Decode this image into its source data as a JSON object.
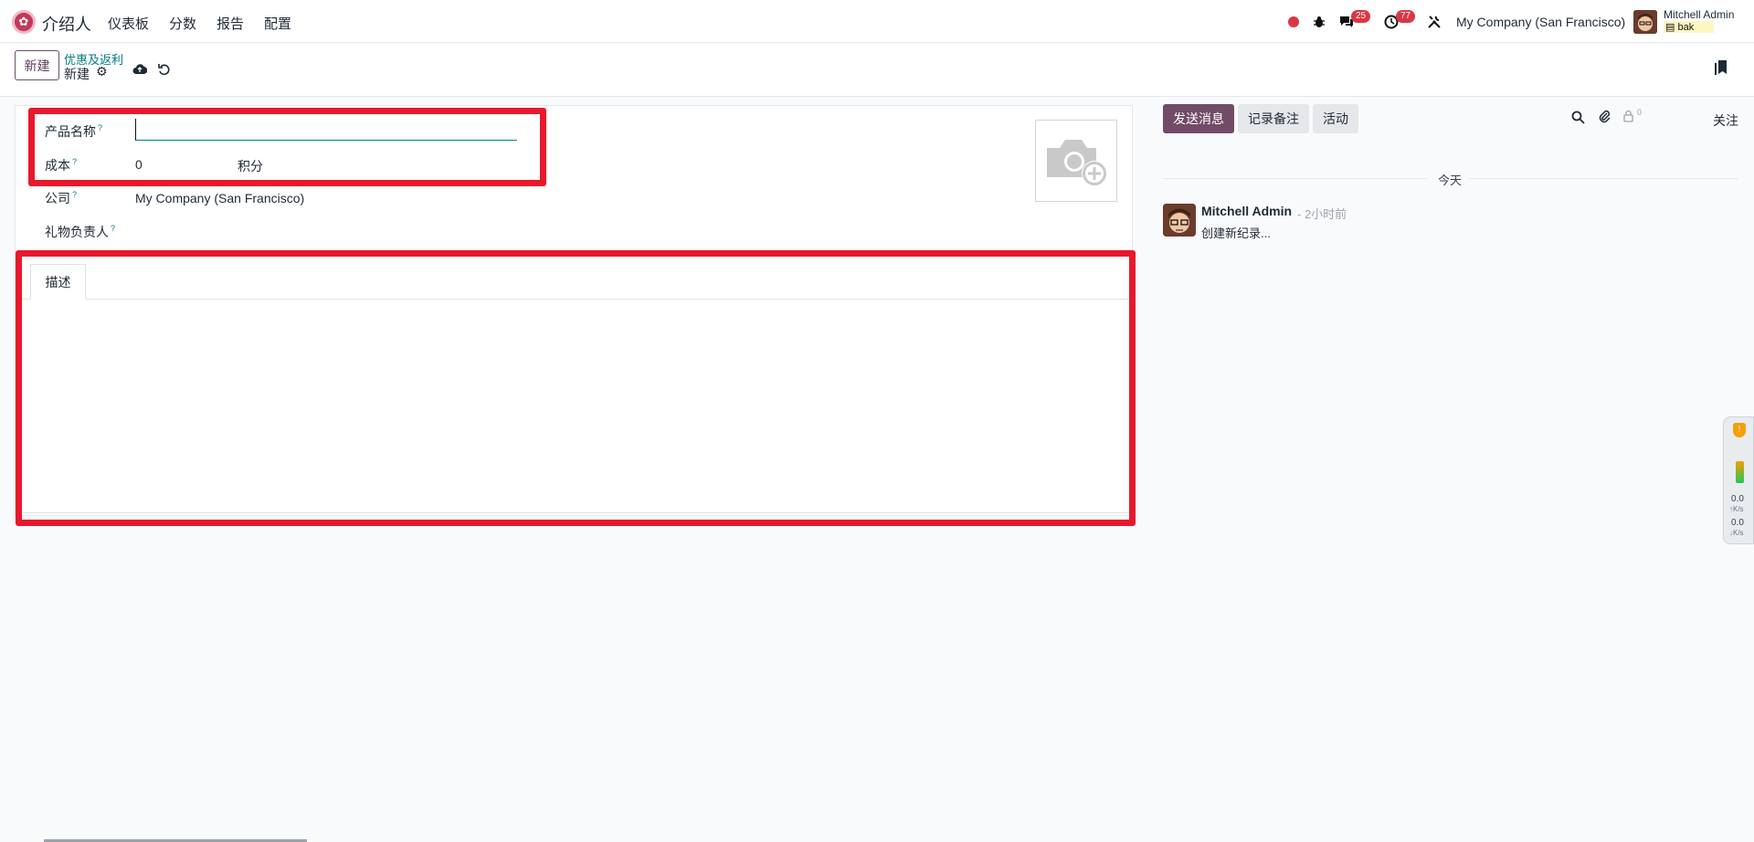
{
  "app": {
    "name": "介绍人",
    "accent": "#714b67"
  },
  "menu": [
    "仪表板",
    "分数",
    "报告",
    "配置"
  ],
  "systray": {
    "messages_count": "25",
    "activities_count": "77",
    "company": "My Company (San Francisco)",
    "user_name": "Mitchell Admin",
    "db_name": "bak"
  },
  "control": {
    "new_label": "新建",
    "breadcrumb_parent": "优惠及返利",
    "breadcrumb_current": "新建"
  },
  "form": {
    "product_name_label": "产品名称",
    "product_name_value": "",
    "cost_label": "成本",
    "cost_value": "0",
    "cost_unit": "积分",
    "company_label": "公司",
    "company_value": "My Company (San Francisco)",
    "gift_manager_label": "礼物负责人",
    "help_mark": "?",
    "tabs": [
      "描述"
    ]
  },
  "chatter": {
    "send_message": "发送消息",
    "log_note": "记录备注",
    "activity": "活动",
    "followers_count": "0",
    "follow": "关注",
    "today": "今天",
    "message": {
      "author": "Mitchell Admin",
      "time": "- 2小时前",
      "body": "创建新纪录..."
    }
  },
  "side_widget": {
    "upload": "0.0",
    "upload_unit": "K/s",
    "download": "0.0",
    "download_unit": "K/s"
  }
}
